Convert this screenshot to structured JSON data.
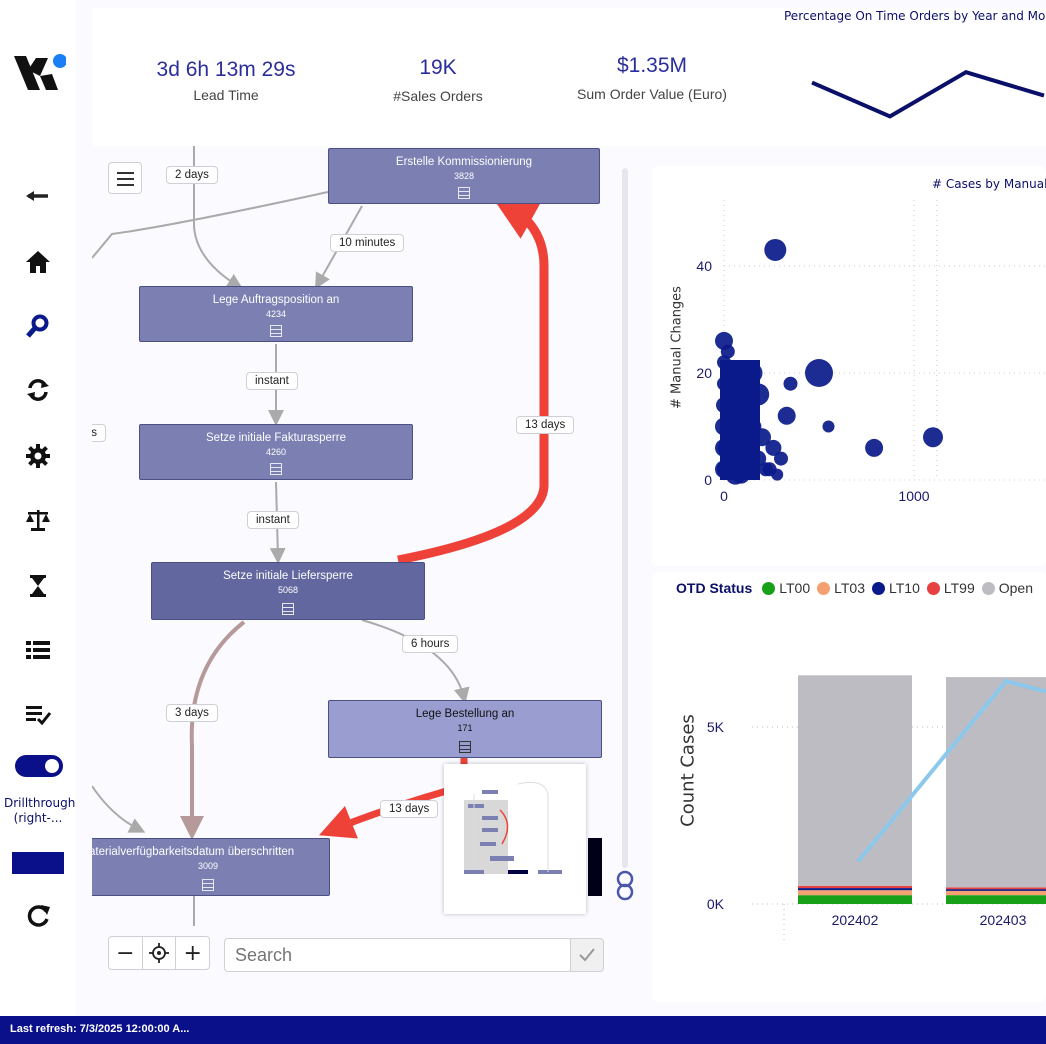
{
  "sidebar": {
    "items": [
      {
        "name": "back-arrow-icon"
      },
      {
        "name": "home-icon"
      },
      {
        "name": "search-icon"
      },
      {
        "name": "refresh-cycle-icon"
      },
      {
        "name": "gear-icon"
      },
      {
        "name": "scale-icon"
      },
      {
        "name": "hourglass-icon"
      },
      {
        "name": "table-list-icon"
      },
      {
        "name": "checklist-icon"
      }
    ],
    "drillthrough_label": "Drillthrough (right-...",
    "reload_icon": "reload-icon",
    "accent": "#0a0f8a"
  },
  "kpis": [
    {
      "value": "3d 6h 13m 29s",
      "label": "Lead Time"
    },
    {
      "value": "19K",
      "label": "#Sales Orders"
    },
    {
      "value": "$1.35M",
      "label": "Sum Order Value (Euro)"
    }
  ],
  "pct_chart": {
    "title": "Percentage On Time Orders by Year and Mo",
    "type": "line",
    "values": [
      68,
      42,
      76,
      58
    ],
    "color": "#0a0f6a"
  },
  "process_map": {
    "nodes": [
      {
        "name": "Erstelle Kommissionierung",
        "count": "3828"
      },
      {
        "name": "Lege Auftragsposition an",
        "count": "4234"
      },
      {
        "name": "Setze initiale Fakturasperre",
        "count": "4260"
      },
      {
        "name": "Setze initiale Liefersperre",
        "count": "5068"
      },
      {
        "name": "Lege Bestellung an",
        "count": "171"
      },
      {
        "name": "aterialverfügbarkeitsdatum überschritten",
        "count": "3009"
      }
    ],
    "edges": [
      "2 days",
      "10 minutes",
      "instant",
      "instant",
      "13 days",
      "6 hours",
      "3 days",
      "13 days",
      "urs"
    ],
    "search_placeholder": "Search",
    "zoom_out": "−",
    "zoom_in": "+",
    "highlight_color": "#ee4238"
  },
  "scatter": {
    "title": "# Cases by Manual",
    "ylabel": "# Manual Changes",
    "yticks": [
      "0",
      "20",
      "40"
    ],
    "xticks": [
      "0",
      "1000"
    ],
    "color": "#0a1a8a"
  },
  "otd": {
    "legend_title": "OTD Status",
    "legend": [
      {
        "name": "LT00",
        "color": "#18a018"
      },
      {
        "name": "LT03",
        "color": "#f5a070"
      },
      {
        "name": "LT10",
        "color": "#0a1a8a"
      },
      {
        "name": "LT99",
        "color": "#e84040"
      },
      {
        "name": "Open",
        "color": "#bdbcc2"
      }
    ]
  },
  "chart_data": {
    "type": "bar",
    "title": "",
    "ylabel": "Count Cases",
    "yticks": [
      "0K",
      "5K"
    ],
    "categories": [
      "202402",
      "202403"
    ],
    "series": [
      {
        "name": "LT00",
        "values": [
          250,
          250
        ]
      },
      {
        "name": "LT03",
        "values": [
          140,
          120
        ]
      },
      {
        "name": "LT10",
        "values": [
          60,
          50
        ]
      },
      {
        "name": "LT99",
        "values": [
          60,
          50
        ]
      },
      {
        "name": "Open",
        "values": [
          5950,
          5940
        ]
      }
    ],
    "line": {
      "values": [
        1200,
        6300
      ],
      "color": "#8cc8ec"
    },
    "ylim": [
      0,
      7000
    ]
  },
  "footer": {
    "last_refresh": "Last refresh: 7/3/2025 12:00:00 A..."
  }
}
